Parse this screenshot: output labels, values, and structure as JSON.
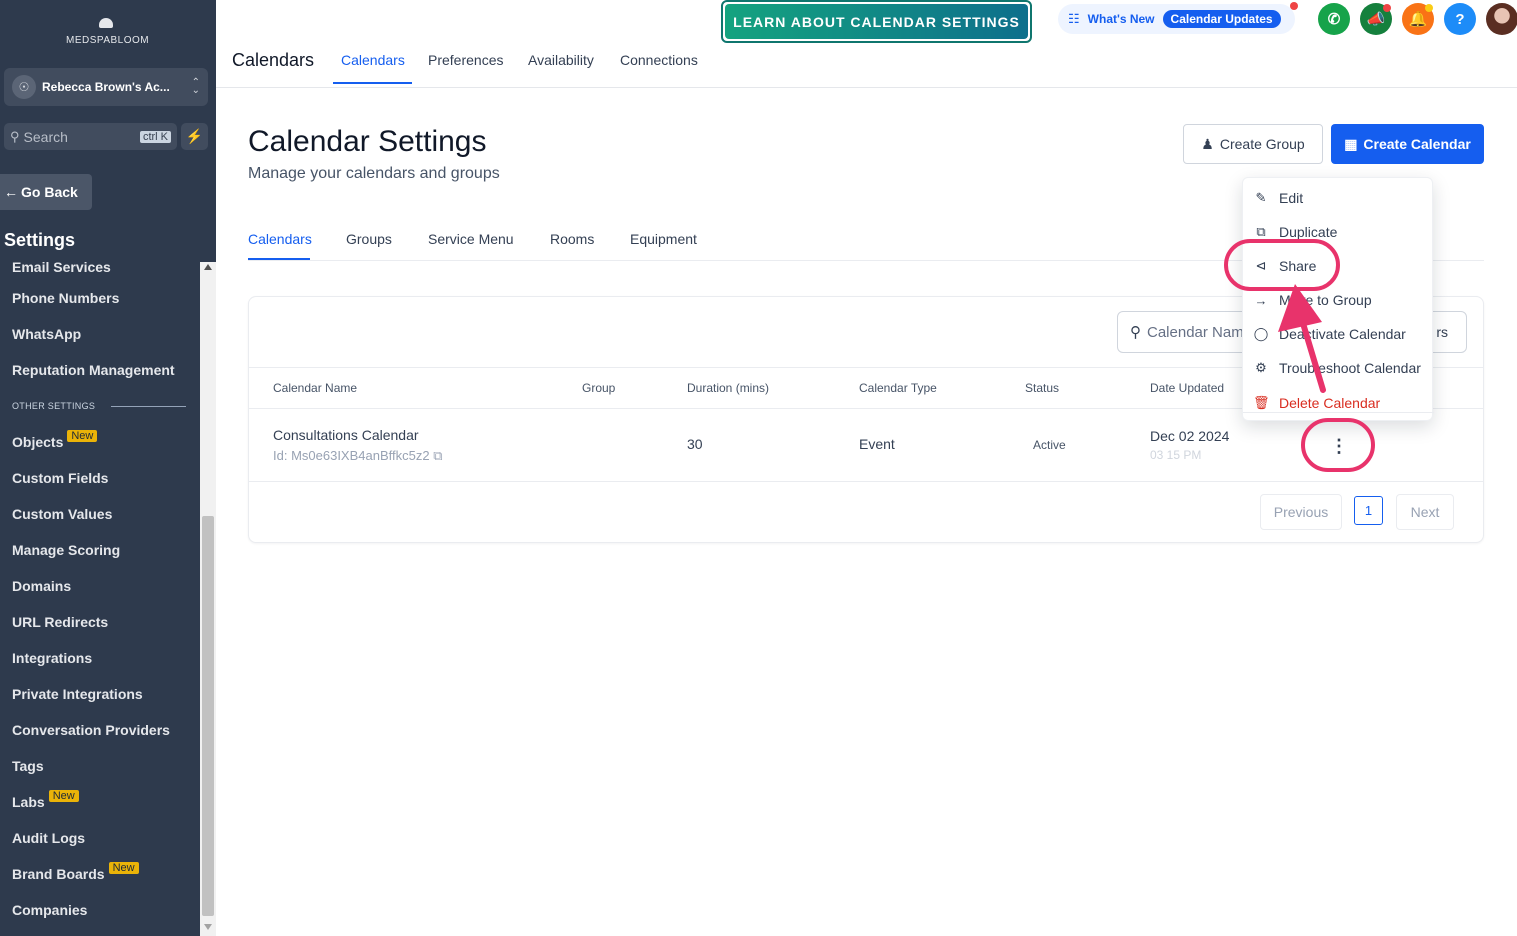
{
  "sidebar": {
    "logo_text": "MEDSPABLOOM",
    "account_name": "Rebecca Brown's Ac...",
    "search_placeholder": "Search",
    "search_shortcut": "ctrl K",
    "go_back": "Go Back",
    "section_title": "Settings",
    "items": [
      {
        "label": "Email Services"
      },
      {
        "label": "Phone Numbers"
      },
      {
        "label": "WhatsApp"
      },
      {
        "label": "Reputation Management"
      }
    ],
    "other_settings_label": "OTHER SETTINGS",
    "other_items": [
      {
        "label": "Objects",
        "badge": "New"
      },
      {
        "label": "Custom Fields"
      },
      {
        "label": "Custom Values"
      },
      {
        "label": "Manage Scoring"
      },
      {
        "label": "Domains"
      },
      {
        "label": "URL Redirects"
      },
      {
        "label": "Integrations"
      },
      {
        "label": "Private Integrations"
      },
      {
        "label": "Conversation Providers"
      },
      {
        "label": "Tags"
      },
      {
        "label": "Labs",
        "badge": "New"
      },
      {
        "label": "Audit Logs"
      },
      {
        "label": "Brand Boards",
        "badge": "New"
      },
      {
        "label": "Companies"
      }
    ]
  },
  "topbar": {
    "title": "Calendars",
    "tabs": [
      "Calendars",
      "Preferences",
      "Availability",
      "Connections"
    ],
    "active_tab": "Calendars",
    "learn_button": "LEARN ABOUT CALENDAR SETTINGS",
    "whats_new": "What's New",
    "calendar_updates": "Calendar Updates",
    "help_glyph": "?",
    "icons": [
      "phone-icon",
      "megaphone-icon",
      "bell-icon",
      "help-icon",
      "avatar"
    ],
    "colors": {
      "phone": "#16a34a",
      "megaphone": "#15803d",
      "bell": "#f97316",
      "help": "#1d8cf8"
    }
  },
  "main": {
    "title": "Calendar Settings",
    "subtitle": "Manage your calendars and groups",
    "create_group": "Create Group",
    "create_calendar": "Create Calendar",
    "subtabs": [
      "Calendars",
      "Groups",
      "Service Menu",
      "Rooms",
      "Equipment"
    ],
    "active_subtab": "Calendars",
    "search_placeholder": "Calendar Name",
    "filter_label": "rs",
    "columns": [
      "Calendar Name",
      "Group",
      "Duration (mins)",
      "Calendar Type",
      "Status",
      "Date Updated"
    ],
    "rows": [
      {
        "name": "Consultations Calendar",
        "id": "Id: Ms0e63IXB4anBffkc5z2",
        "group": "",
        "duration": "30",
        "type": "Event",
        "status": "Active",
        "date": "Dec 02 2024",
        "time": "03 15 PM"
      }
    ],
    "pagination": {
      "previous": "Previous",
      "page": "1",
      "next": "Next"
    }
  },
  "menu": {
    "items": [
      {
        "label": "Edit",
        "icon": "pencil-icon"
      },
      {
        "label": "Duplicate",
        "icon": "copy-icon"
      },
      {
        "label": "Share",
        "icon": "share-icon"
      },
      {
        "label": "Move to Group",
        "icon": "arrow-right-icon"
      },
      {
        "label": "Deactivate Calendar",
        "icon": "toggle-icon"
      },
      {
        "label": "Troubleshoot Calendar",
        "icon": "gear-icon"
      },
      {
        "label": "Delete Calendar",
        "icon": "trash-icon"
      }
    ]
  },
  "annotation_color": "#e8336b"
}
